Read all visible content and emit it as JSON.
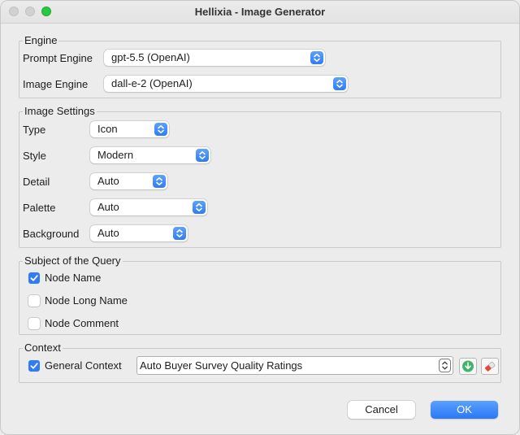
{
  "window": {
    "title": "Hellixia - Image Generator"
  },
  "engine": {
    "legend": "Engine",
    "prompt_label": "Prompt Engine",
    "prompt_value": "gpt-5.5 (OpenAI)",
    "image_label": "Image Engine",
    "image_value": "dall-e-2 (OpenAI)"
  },
  "image_settings": {
    "legend": "Image Settings",
    "type_label": "Type",
    "type_value": "Icon",
    "style_label": "Style",
    "style_value": "Modern",
    "detail_label": "Detail",
    "detail_value": "Auto",
    "palette_label": "Palette",
    "palette_value": "Auto",
    "background_label": "Background",
    "background_value": "Auto"
  },
  "subject": {
    "legend": "Subject of the Query",
    "items": [
      {
        "label": "Node Name",
        "checked": true
      },
      {
        "label": "Node Long Name",
        "checked": false
      },
      {
        "label": "Node Comment",
        "checked": false
      }
    ]
  },
  "context": {
    "legend": "Context",
    "general_label": "General Context",
    "general_checked": true,
    "value": "Auto Buyer Survey Quality Ratings",
    "icons": [
      "download-icon",
      "eraser-icon"
    ]
  },
  "buttons": {
    "cancel": "Cancel",
    "ok": "OK"
  },
  "colors": {
    "accent": "#2f7cf6",
    "background": "#ececec"
  }
}
